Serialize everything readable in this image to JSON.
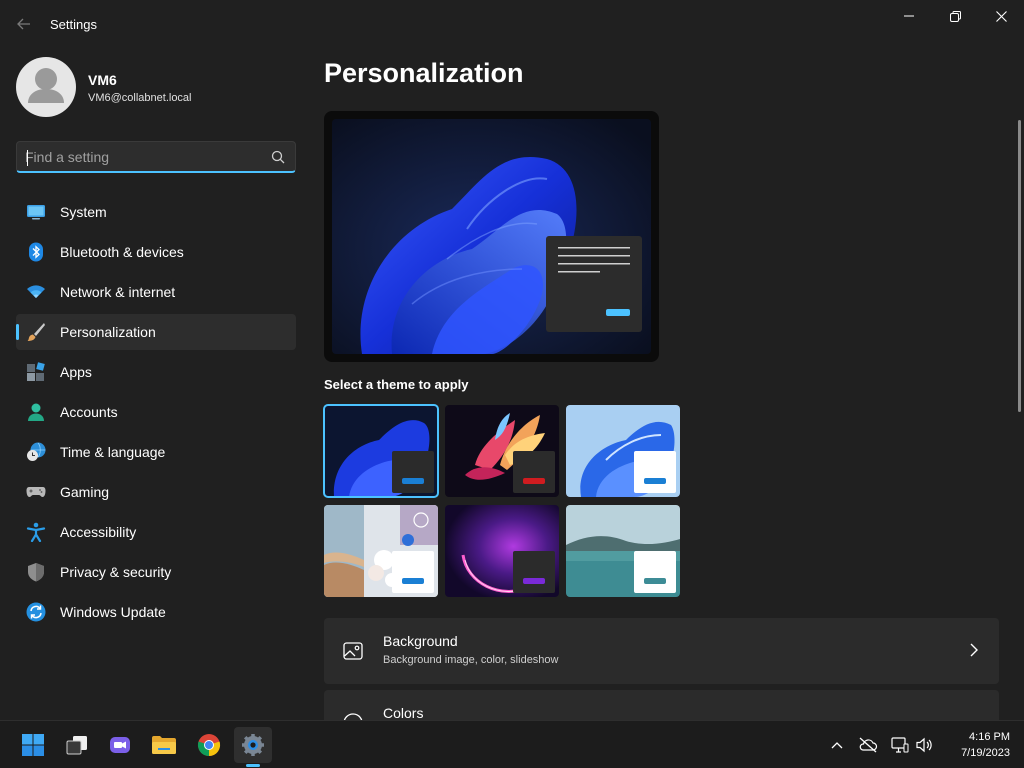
{
  "window": {
    "title": "Settings",
    "controls": {
      "minimize": "minimize-icon",
      "maximize": "restore-icon",
      "close": "close-icon"
    }
  },
  "user": {
    "name": "VM6",
    "email": "VM6@collabnet.local"
  },
  "search": {
    "placeholder": "Find a setting",
    "value": ""
  },
  "sidebar": {
    "items": [
      {
        "label": "System",
        "icon": "system-icon"
      },
      {
        "label": "Bluetooth & devices",
        "icon": "bluetooth-icon"
      },
      {
        "label": "Network & internet",
        "icon": "wifi-icon"
      },
      {
        "label": "Personalization",
        "icon": "brush-icon",
        "active": true
      },
      {
        "label": "Apps",
        "icon": "apps-icon"
      },
      {
        "label": "Accounts",
        "icon": "accounts-icon"
      },
      {
        "label": "Time & language",
        "icon": "clock-globe-icon"
      },
      {
        "label": "Gaming",
        "icon": "gamepad-icon"
      },
      {
        "label": "Accessibility",
        "icon": "accessibility-icon"
      },
      {
        "label": "Privacy & security",
        "icon": "shield-icon"
      },
      {
        "label": "Windows Update",
        "icon": "update-icon"
      }
    ]
  },
  "main": {
    "title": "Personalization",
    "themes_label": "Select a theme to apply",
    "themes": [
      {
        "name": "windows-dark-theme",
        "selected": true
      },
      {
        "name": "glow-theme"
      },
      {
        "name": "windows-light-theme"
      },
      {
        "name": "captured-motion-theme"
      },
      {
        "name": "sunrise-theme"
      },
      {
        "name": "flow-theme"
      }
    ],
    "cards": [
      {
        "title": "Background",
        "subtitle": "Background image, color, slideshow",
        "icon": "image-icon"
      },
      {
        "title": "Colors",
        "subtitle": "",
        "icon": "palette-icon"
      }
    ]
  },
  "taskbar": {
    "apps": [
      "start-icon",
      "task-view-icon",
      "teams-chat-icon",
      "file-explorer-icon",
      "chrome-icon",
      "settings-icon"
    ],
    "tray": [
      "chevron-up-icon",
      "onedrive-offline-icon",
      "network-icon",
      "volume-icon"
    ],
    "time": "4:16 PM",
    "date": "7/19/2023"
  },
  "colors": {
    "accent": "#4cc2ff",
    "background": "#202020",
    "card": "#2b2b2b",
    "taskbar": "#1c1c1c"
  }
}
